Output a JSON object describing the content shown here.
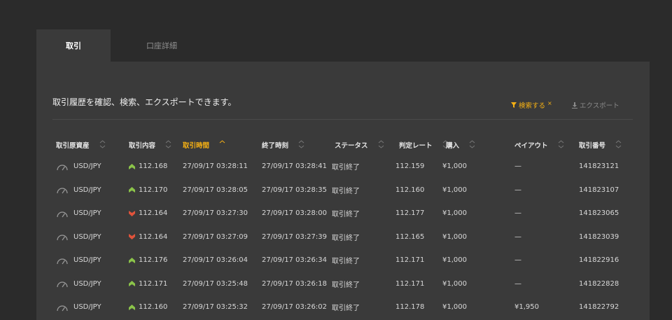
{
  "tabs": [
    {
      "label": "取引",
      "active": true
    },
    {
      "label": "口座詳細",
      "active": false
    }
  ],
  "description": "取引履歴を確認、検索、エクスポートできます。",
  "actions": {
    "search_label": "検索する",
    "search_clear": "×",
    "export_label": "エクスポート"
  },
  "colors": {
    "accent": "#f5b014",
    "up": "#8bc34a",
    "down": "#e0533b"
  },
  "table": {
    "columns": [
      {
        "key": "asset",
        "label": "取引原資産"
      },
      {
        "key": "content",
        "label": "取引内容"
      },
      {
        "key": "trade_time",
        "label": "取引時間",
        "sorted": true
      },
      {
        "key": "end_time",
        "label": "終了時刻"
      },
      {
        "key": "status",
        "label": "ステータス"
      },
      {
        "key": "rate",
        "label": "判定レート"
      },
      {
        "key": "purchase",
        "label": "購入"
      },
      {
        "key": "payout",
        "label": "ペイアウト"
      },
      {
        "key": "trade_no",
        "label": "取引番号"
      }
    ],
    "rows": [
      {
        "asset": "USD/JPY",
        "direction": "up",
        "content": "112.168",
        "trade_time": "27/09/17 03:28:11",
        "end_time": "27/09/17 03:28:41",
        "status": "取引終了",
        "rate": "112.159",
        "purchase": "¥1,000",
        "payout": "—",
        "trade_no": "141823121"
      },
      {
        "asset": "USD/JPY",
        "direction": "up",
        "content": "112.170",
        "trade_time": "27/09/17 03:28:05",
        "end_time": "27/09/17 03:28:35",
        "status": "取引終了",
        "rate": "112.160",
        "purchase": "¥1,000",
        "payout": "—",
        "trade_no": "141823107"
      },
      {
        "asset": "USD/JPY",
        "direction": "down",
        "content": "112.164",
        "trade_time": "27/09/17 03:27:30",
        "end_time": "27/09/17 03:28:00",
        "status": "取引終了",
        "rate": "112.177",
        "purchase": "¥1,000",
        "payout": "—",
        "trade_no": "141823065"
      },
      {
        "asset": "USD/JPY",
        "direction": "down",
        "content": "112.164",
        "trade_time": "27/09/17 03:27:09",
        "end_time": "27/09/17 03:27:39",
        "status": "取引終了",
        "rate": "112.165",
        "purchase": "¥1,000",
        "payout": "—",
        "trade_no": "141823039"
      },
      {
        "asset": "USD/JPY",
        "direction": "up",
        "content": "112.176",
        "trade_time": "27/09/17 03:26:04",
        "end_time": "27/09/17 03:26:34",
        "status": "取引終了",
        "rate": "112.171",
        "purchase": "¥1,000",
        "payout": "—",
        "trade_no": "141822916"
      },
      {
        "asset": "USD/JPY",
        "direction": "up",
        "content": "112.171",
        "trade_time": "27/09/17 03:25:48",
        "end_time": "27/09/17 03:26:18",
        "status": "取引終了",
        "rate": "112.171",
        "purchase": "¥1,000",
        "payout": "—",
        "trade_no": "141822828"
      },
      {
        "asset": "USD/JPY",
        "direction": "up",
        "content": "112.160",
        "trade_time": "27/09/17 03:25:32",
        "end_time": "27/09/17 03:26:02",
        "status": "取引終了",
        "rate": "112.178",
        "purchase": "¥1,000",
        "payout": "¥1,950",
        "trade_no": "141822792"
      }
    ]
  }
}
